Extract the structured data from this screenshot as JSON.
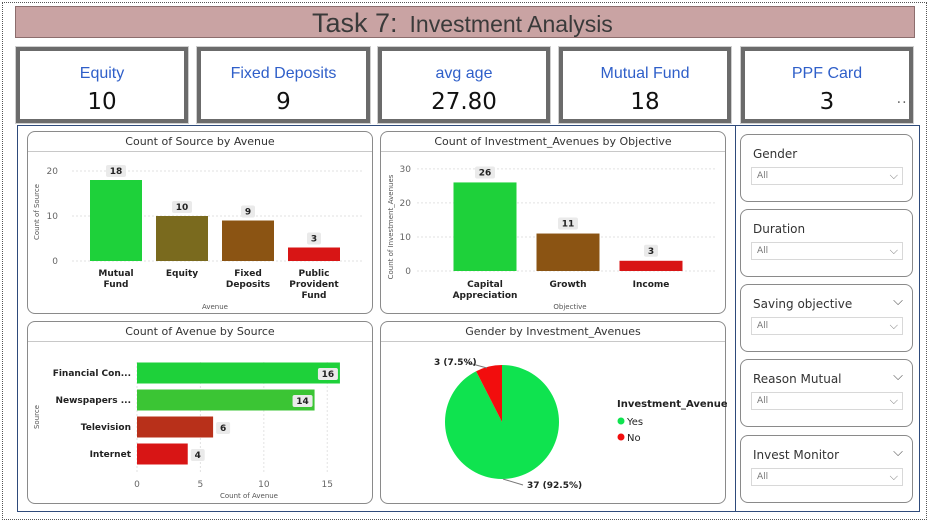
{
  "title": {
    "task": "Task 7:",
    "name": "Investment Analysis"
  },
  "kpis": [
    {
      "label": "Equity",
      "value": "10"
    },
    {
      "label": "Fixed Deposits",
      "value": "9"
    },
    {
      "label": "avg age",
      "value": "27.80"
    },
    {
      "label": "Mutual Fund",
      "value": "18"
    },
    {
      "label": "PPF Card",
      "value": "3"
    }
  ],
  "kpi_more": "···",
  "slicers": [
    {
      "title": "Gender",
      "value": "All",
      "has_chevron": false
    },
    {
      "title": "Duration",
      "value": "All",
      "has_chevron": false
    },
    {
      "title": "Saving objective",
      "value": "All",
      "has_chevron": true
    },
    {
      "title": "Reason Mutual",
      "value": "All",
      "has_chevron": true
    },
    {
      "title": "Invest Monitor",
      "value": "All",
      "has_chevron": true
    }
  ],
  "icons": {
    "dropdown": "chevron-down-icon",
    "more": "more-options-icon"
  },
  "colors": {
    "green": "#1ed13a",
    "olive": "#7a6a1e",
    "brown": "#8b5413",
    "red": "#d81515",
    "bar_green_2": "#3bc534",
    "bar_red_2": "#b8301a",
    "pie_green": "#0fe34f",
    "pie_red": "#f20d0d",
    "kpi_label": "#2f5fc9",
    "title_bg": "#c9a3a3"
  },
  "chart_data": [
    {
      "type": "bar",
      "title": "Count of Source by Avenue",
      "xlabel": "Avenue",
      "ylabel": "Count of Source",
      "categories": [
        "Mutual Fund",
        "Equity",
        "Fixed Deposits",
        "Public Provident Fund"
      ],
      "values": [
        18,
        10,
        9,
        3
      ],
      "yticks": [
        0,
        10,
        20
      ],
      "ylim": [
        0,
        22
      ],
      "grid": true,
      "data_labels": true
    },
    {
      "type": "bar",
      "title": "Count of Investment_Avenues by Objective",
      "xlabel": "Objective",
      "ylabel": "Count of Investment_Avenues",
      "categories": [
        "Capital Appreciation",
        "Growth",
        "Income"
      ],
      "values": [
        26,
        11,
        3
      ],
      "yticks": [
        0,
        10,
        20,
        30
      ],
      "ylim": [
        0,
        32
      ],
      "grid": true,
      "data_labels": true
    },
    {
      "type": "bar",
      "orientation": "horizontal",
      "title": "Count of Avenue by Source",
      "xlabel": "Count of Avenue",
      "ylabel": "Source",
      "categories": [
        "Financial Con...",
        "Newspapers ...",
        "Television",
        "Internet"
      ],
      "values": [
        16,
        14,
        6,
        4
      ],
      "xticks": [
        0,
        5,
        10,
        15
      ],
      "xlim": [
        0,
        16.4
      ],
      "grid": true,
      "data_labels": true
    },
    {
      "type": "pie",
      "title": "Gender by Investment_Avenues",
      "legend_title": "Investment_Avenues",
      "legend_position": "right",
      "slices": [
        {
          "label": "Yes",
          "value": 37,
          "display": "37 (92.5%)"
        },
        {
          "label": "No",
          "value": 3,
          "display": "3 (7.5%)"
        }
      ]
    }
  ]
}
